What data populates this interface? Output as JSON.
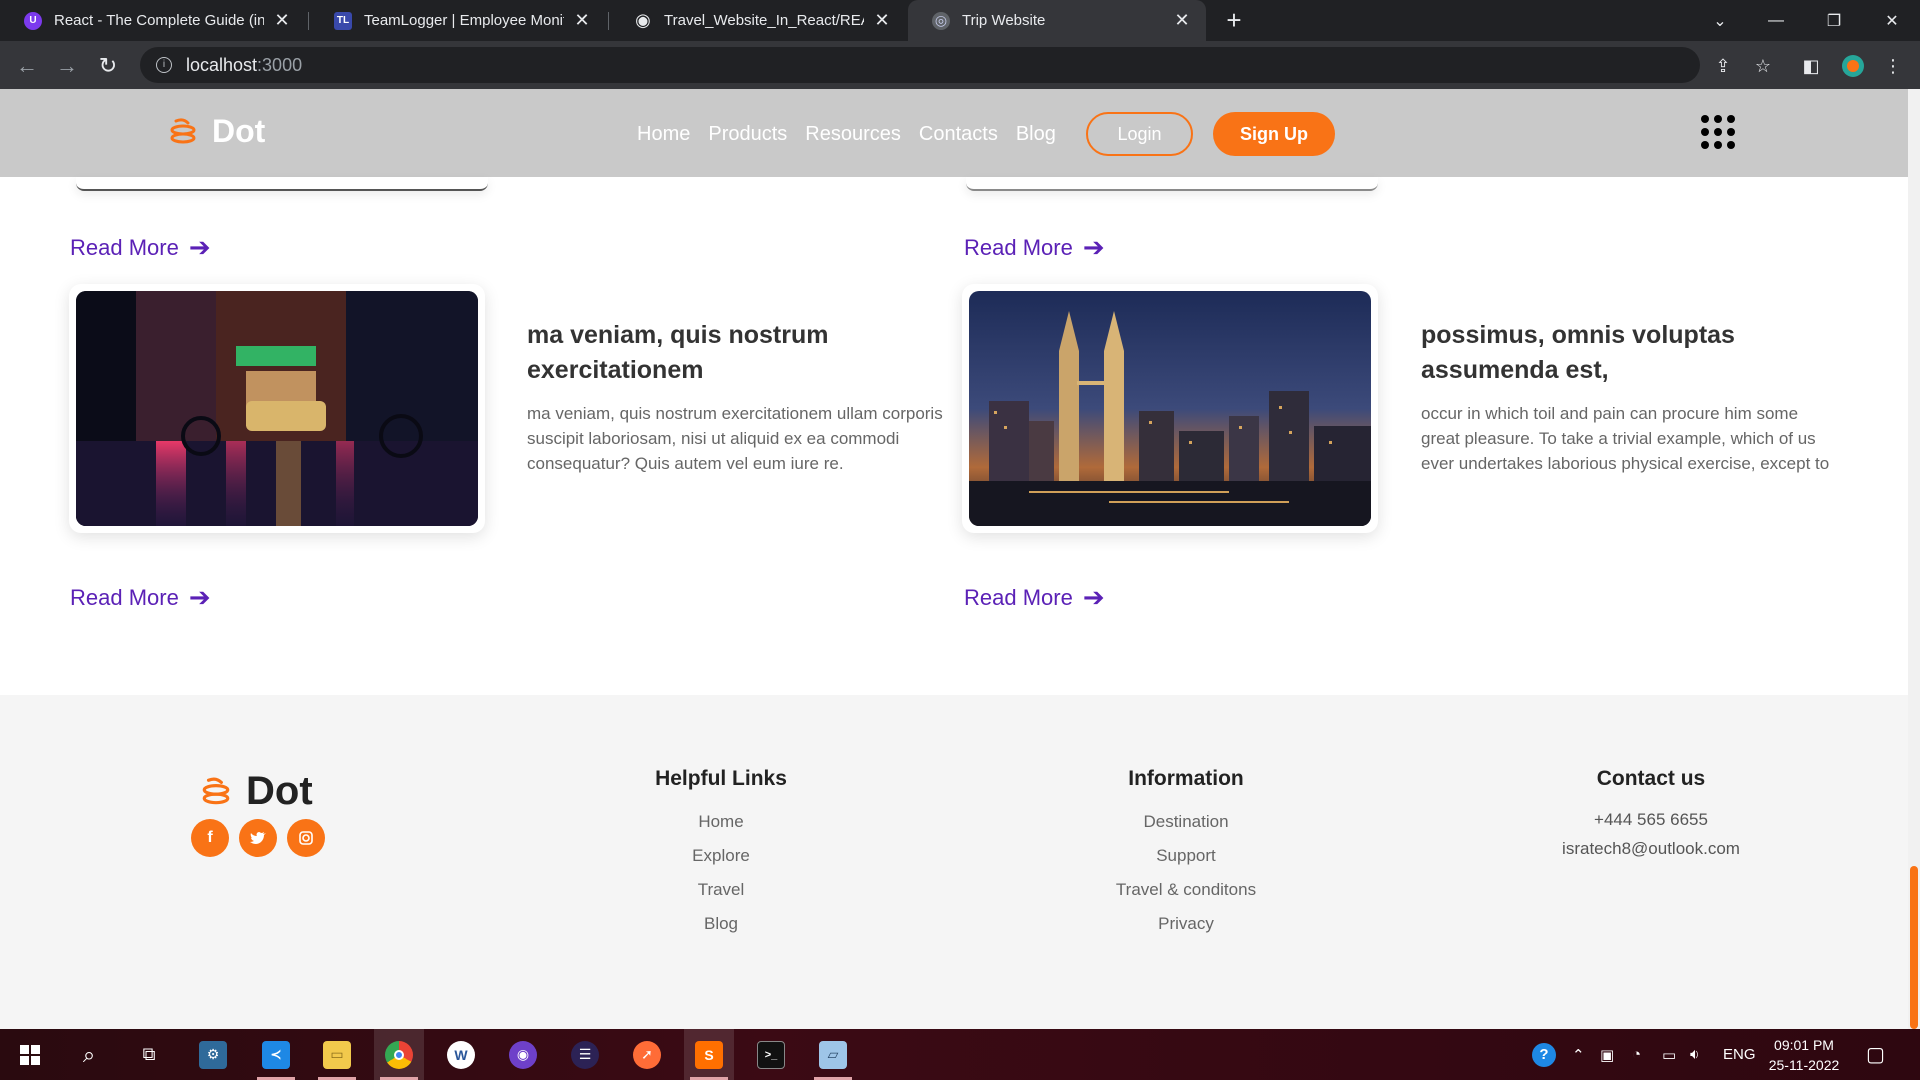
{
  "browser": {
    "tabs": [
      {
        "title": "React - The Complete Guide (incl",
        "favicon_color": "#7c3aed",
        "favicon_letter": "U"
      },
      {
        "title": "TeamLogger | Employee Monitori",
        "favicon_color": "#3949ab",
        "favicon_letter": "TL"
      },
      {
        "title": "Travel_Website_In_React/READM",
        "favicon_color": "#e8eaed",
        "favicon_letter": "◉"
      },
      {
        "title": "Trip Website",
        "favicon_color": "#5f6368",
        "favicon_letter": "◎"
      }
    ],
    "url_host": "localhost",
    "url_port": ":3000"
  },
  "site": {
    "brand": "Dot",
    "nav": [
      "Home",
      "Products",
      "Resources",
      "Contacts",
      "Blog"
    ],
    "login_label": "Login",
    "signup_label": "Sign Up",
    "accent": "#f97316",
    "link_color": "#5b21b6"
  },
  "posts": [
    {
      "title": "ma veniam, quis nostrum exercitationem",
      "text": "ma veniam, quis nostrum exercitationem ullam corporis suscipit laboriosam, nisi ut aliquid ex ea commodi consequatur? Quis autem vel eum iure re.",
      "image": "night-street-city"
    },
    {
      "title": "possimus, omnis voluptas assumenda est,",
      "text": "occur in which toil and pain can procure him some great pleasure. To take a trivial example, which of us ever undertakes laborious physical exercise, except to",
      "image": "night-skyline-towers"
    }
  ],
  "read_more": "Read More",
  "footer": {
    "brand": "Dot",
    "socials": [
      "facebook-icon",
      "twitter-icon",
      "instagram-icon"
    ],
    "helpful_links": {
      "heading": "Helpful Links",
      "items": [
        "Home",
        "Explore",
        "Travel",
        "Blog"
      ]
    },
    "information": {
      "heading": "Information",
      "items": [
        "Destination",
        "Support",
        "Travel & conditons",
        "Privacy"
      ]
    },
    "contact": {
      "heading": "Contact us",
      "phone": "+444 565 6655",
      "email": "isratech8@outlook.com"
    }
  },
  "taskbar": {
    "lang": "ENG",
    "time": "09:01 PM",
    "date": "25-11-2022"
  }
}
